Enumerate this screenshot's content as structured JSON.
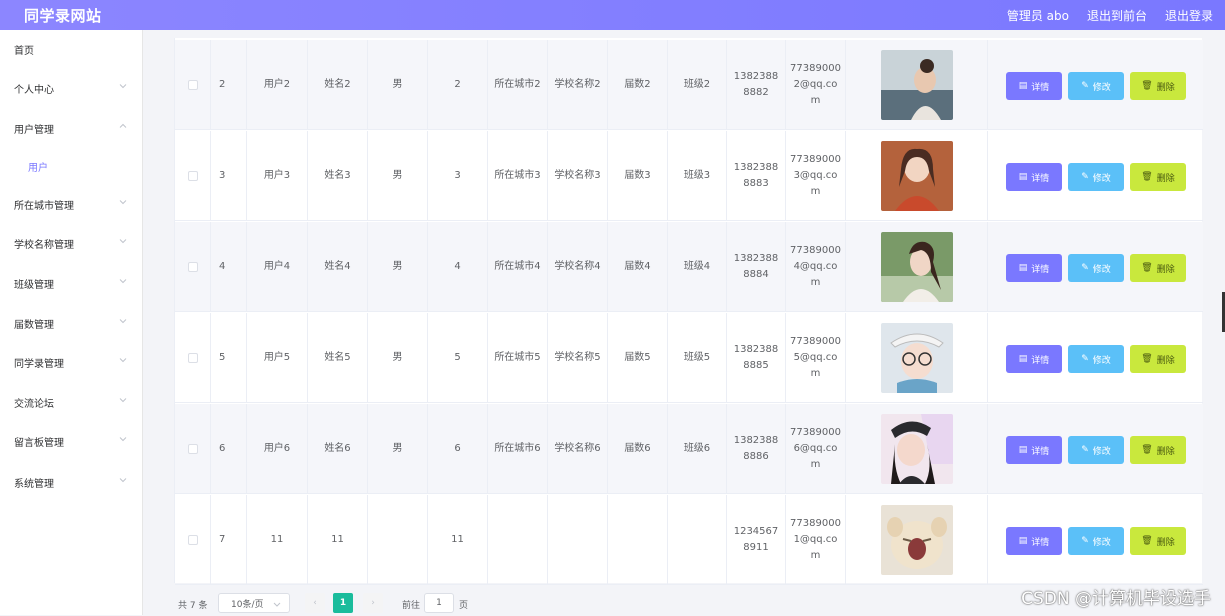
{
  "header": {
    "brand": "同学录网站",
    "admin": "管理员 abo",
    "to_front": "退出到前台",
    "logout": "退出登录"
  },
  "sidebar": {
    "items": [
      {
        "label": "首页",
        "expandable": false
      },
      {
        "label": "个人中心",
        "expandable": true
      },
      {
        "label": "用户管理",
        "expandable": true,
        "expanded": true
      },
      {
        "label": "用户",
        "sub": true
      },
      {
        "label": "所在城市管理",
        "expandable": true
      },
      {
        "label": "学校名称管理",
        "expandable": true
      },
      {
        "label": "班级管理",
        "expandable": true
      },
      {
        "label": "届数管理",
        "expandable": true
      },
      {
        "label": "同学录管理",
        "expandable": true
      },
      {
        "label": "交流论坛",
        "expandable": true
      },
      {
        "label": "留言板管理",
        "expandable": true
      },
      {
        "label": "系统管理",
        "expandable": true
      }
    ]
  },
  "table": {
    "rows": [
      {
        "idx": "2",
        "account": "用户2",
        "name": "姓名2",
        "gender": "男",
        "age": "2",
        "city": "所在城市2",
        "school": "学校名称2",
        "grade": "届数2",
        "class": "班级2",
        "phone": "13823888882",
        "email": "773890002@qq.com",
        "photo": "photo-seaside-girl"
      },
      {
        "idx": "3",
        "account": "用户3",
        "name": "姓名3",
        "gender": "男",
        "age": "3",
        "city": "所在城市3",
        "school": "学校名称3",
        "grade": "届数3",
        "class": "班级3",
        "phone": "13823888883",
        "email": "773890003@qq.com",
        "photo": "photo-red-shirt-girl"
      },
      {
        "idx": "4",
        "account": "用户4",
        "name": "姓名4",
        "gender": "男",
        "age": "4",
        "city": "所在城市4",
        "school": "学校名称4",
        "grade": "届数4",
        "class": "班级4",
        "phone": "13823888884",
        "email": "773890004@qq.com",
        "photo": "photo-ponytail-girl"
      },
      {
        "idx": "5",
        "account": "用户5",
        "name": "姓名5",
        "gender": "男",
        "age": "5",
        "city": "所在城市5",
        "school": "学校名称5",
        "grade": "届数5",
        "class": "班级5",
        "phone": "13823888885",
        "email": "773890005@qq.com",
        "photo": "photo-cap-glasses-girl"
      },
      {
        "idx": "6",
        "account": "用户6",
        "name": "姓名6",
        "gender": "男",
        "age": "6",
        "city": "所在城市6",
        "school": "学校名称6",
        "grade": "届数6",
        "class": "班级6",
        "phone": "13823888886",
        "email": "773890006@qq.com",
        "photo": "photo-cap-girl"
      },
      {
        "idx": "7",
        "account": "11",
        "name": "11",
        "gender": "",
        "age": "11",
        "city": "",
        "school": "",
        "grade": "",
        "class": "",
        "phone": "12345678911",
        "email": "773890001@qq.com",
        "photo": "photo-cat"
      }
    ],
    "actions": {
      "detail": "详情",
      "edit": "修改",
      "delete": "删除"
    }
  },
  "pager": {
    "total": "共 7 条",
    "page_size": "10条/页",
    "current": "1",
    "goto_prefix": "前往",
    "goto_value": "1",
    "goto_suffix": "页"
  },
  "watermark": "CSDN @计算机毕设选手",
  "colors": {
    "header": "#7a78ff",
    "detail": "#7a78ff",
    "edit": "#5bc0f8",
    "delete": "#c9e83d",
    "current_page": "#1abc9c"
  }
}
